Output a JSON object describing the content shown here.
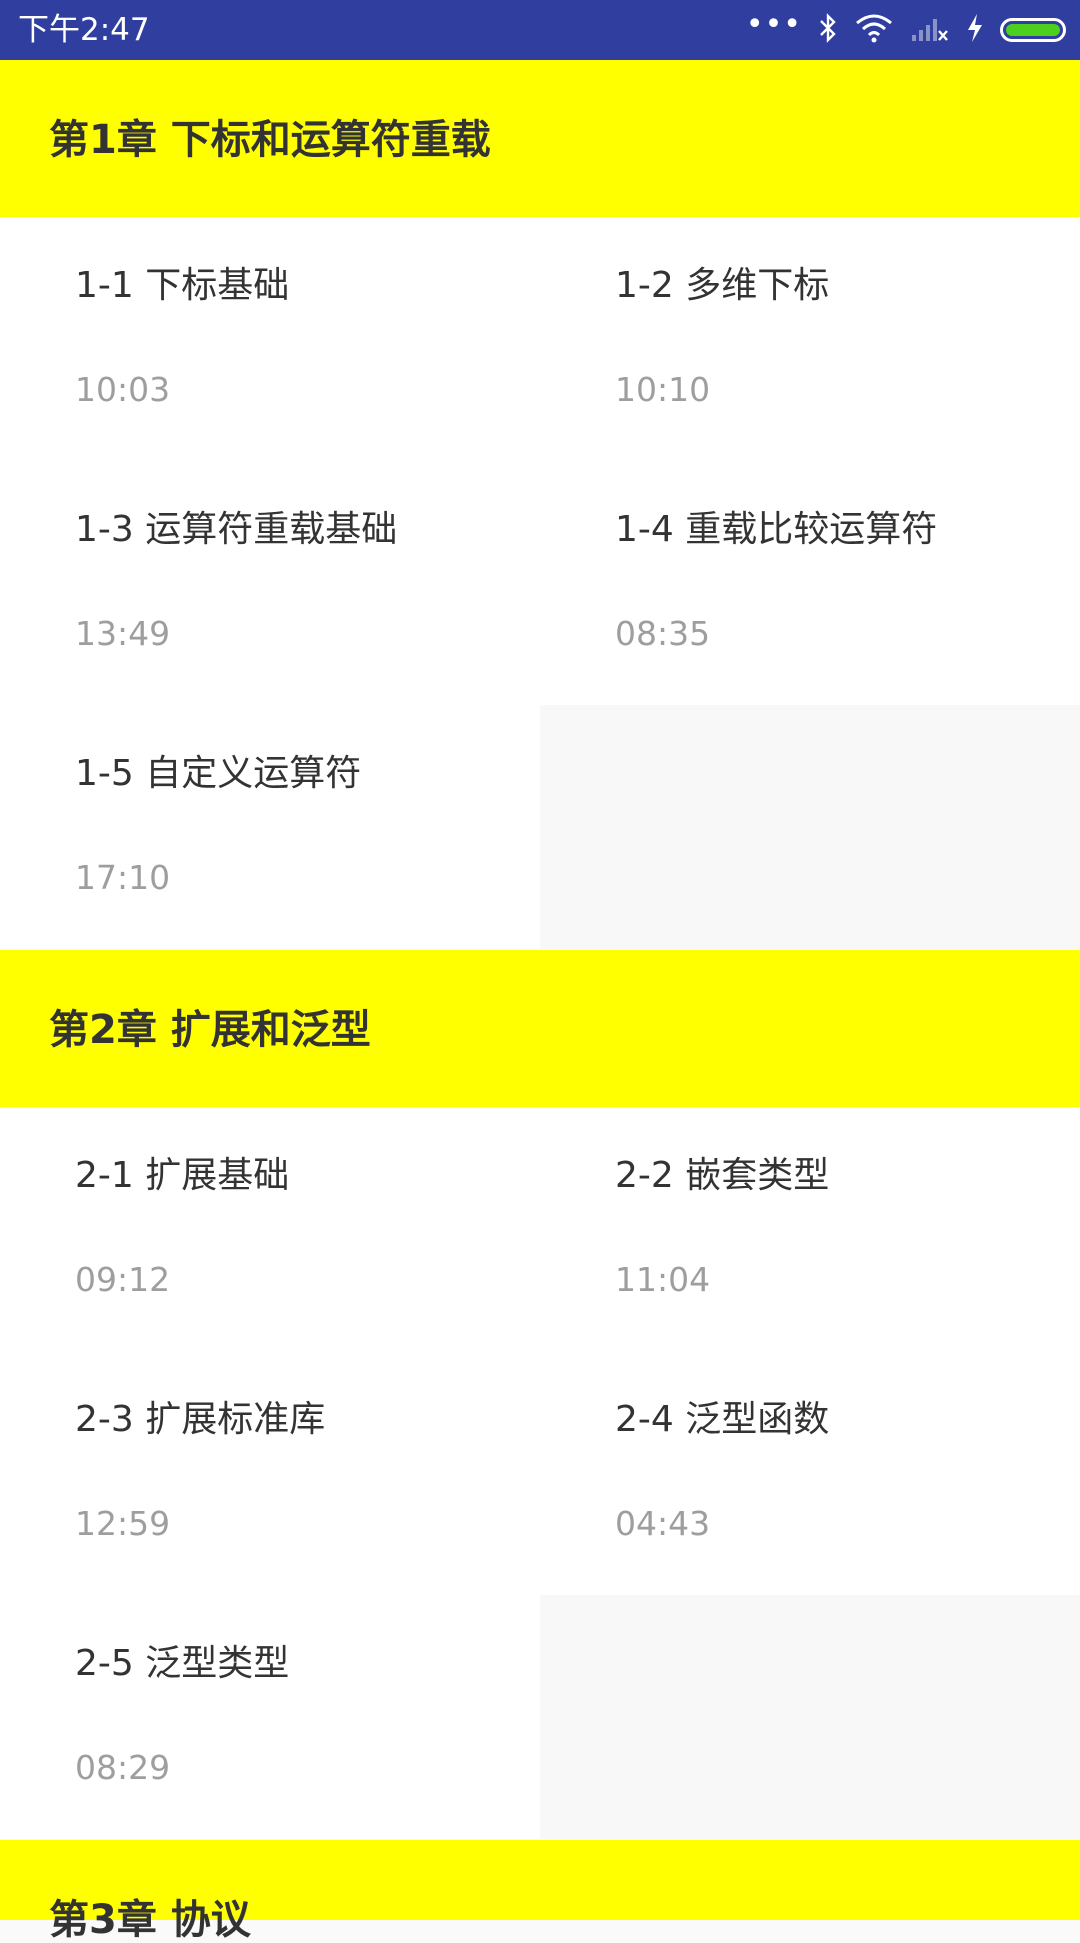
{
  "status_bar": {
    "time": "下午2:47",
    "icons": [
      "more-dots-icon",
      "bluetooth-icon",
      "wifi-icon",
      "signal-icon",
      "charging-icon",
      "battery-icon"
    ],
    "background": "#303f9f",
    "battery_color": "#4ccf1e"
  },
  "colors": {
    "chapter_header_bg": "#ffff00",
    "lesson_bg": "#ffffff",
    "duration_text": "#9e9e9e"
  },
  "chapters": [
    {
      "title": "第1章 下标和运算符重载",
      "lessons": [
        {
          "title": "1-1 下标基础",
          "duration": "10:03"
        },
        {
          "title": "1-2 多维下标",
          "duration": "10:10"
        },
        {
          "title": "1-3 运算符重载基础",
          "duration": "13:49"
        },
        {
          "title": "1-4 重载比较运算符",
          "duration": "08:35"
        },
        {
          "title": "1-5 自定义运算符",
          "duration": "17:10"
        }
      ]
    },
    {
      "title": "第2章 扩展和泛型",
      "lessons": [
        {
          "title": "2-1 扩展基础",
          "duration": "09:12"
        },
        {
          "title": "2-2 嵌套类型",
          "duration": "11:04"
        },
        {
          "title": "2-3 扩展标准库",
          "duration": "12:59"
        },
        {
          "title": "2-4 泛型函数",
          "duration": "04:43"
        },
        {
          "title": "2-5 泛型类型",
          "duration": "08:29"
        }
      ]
    },
    {
      "title": "第3章 协议",
      "lessons": []
    }
  ]
}
